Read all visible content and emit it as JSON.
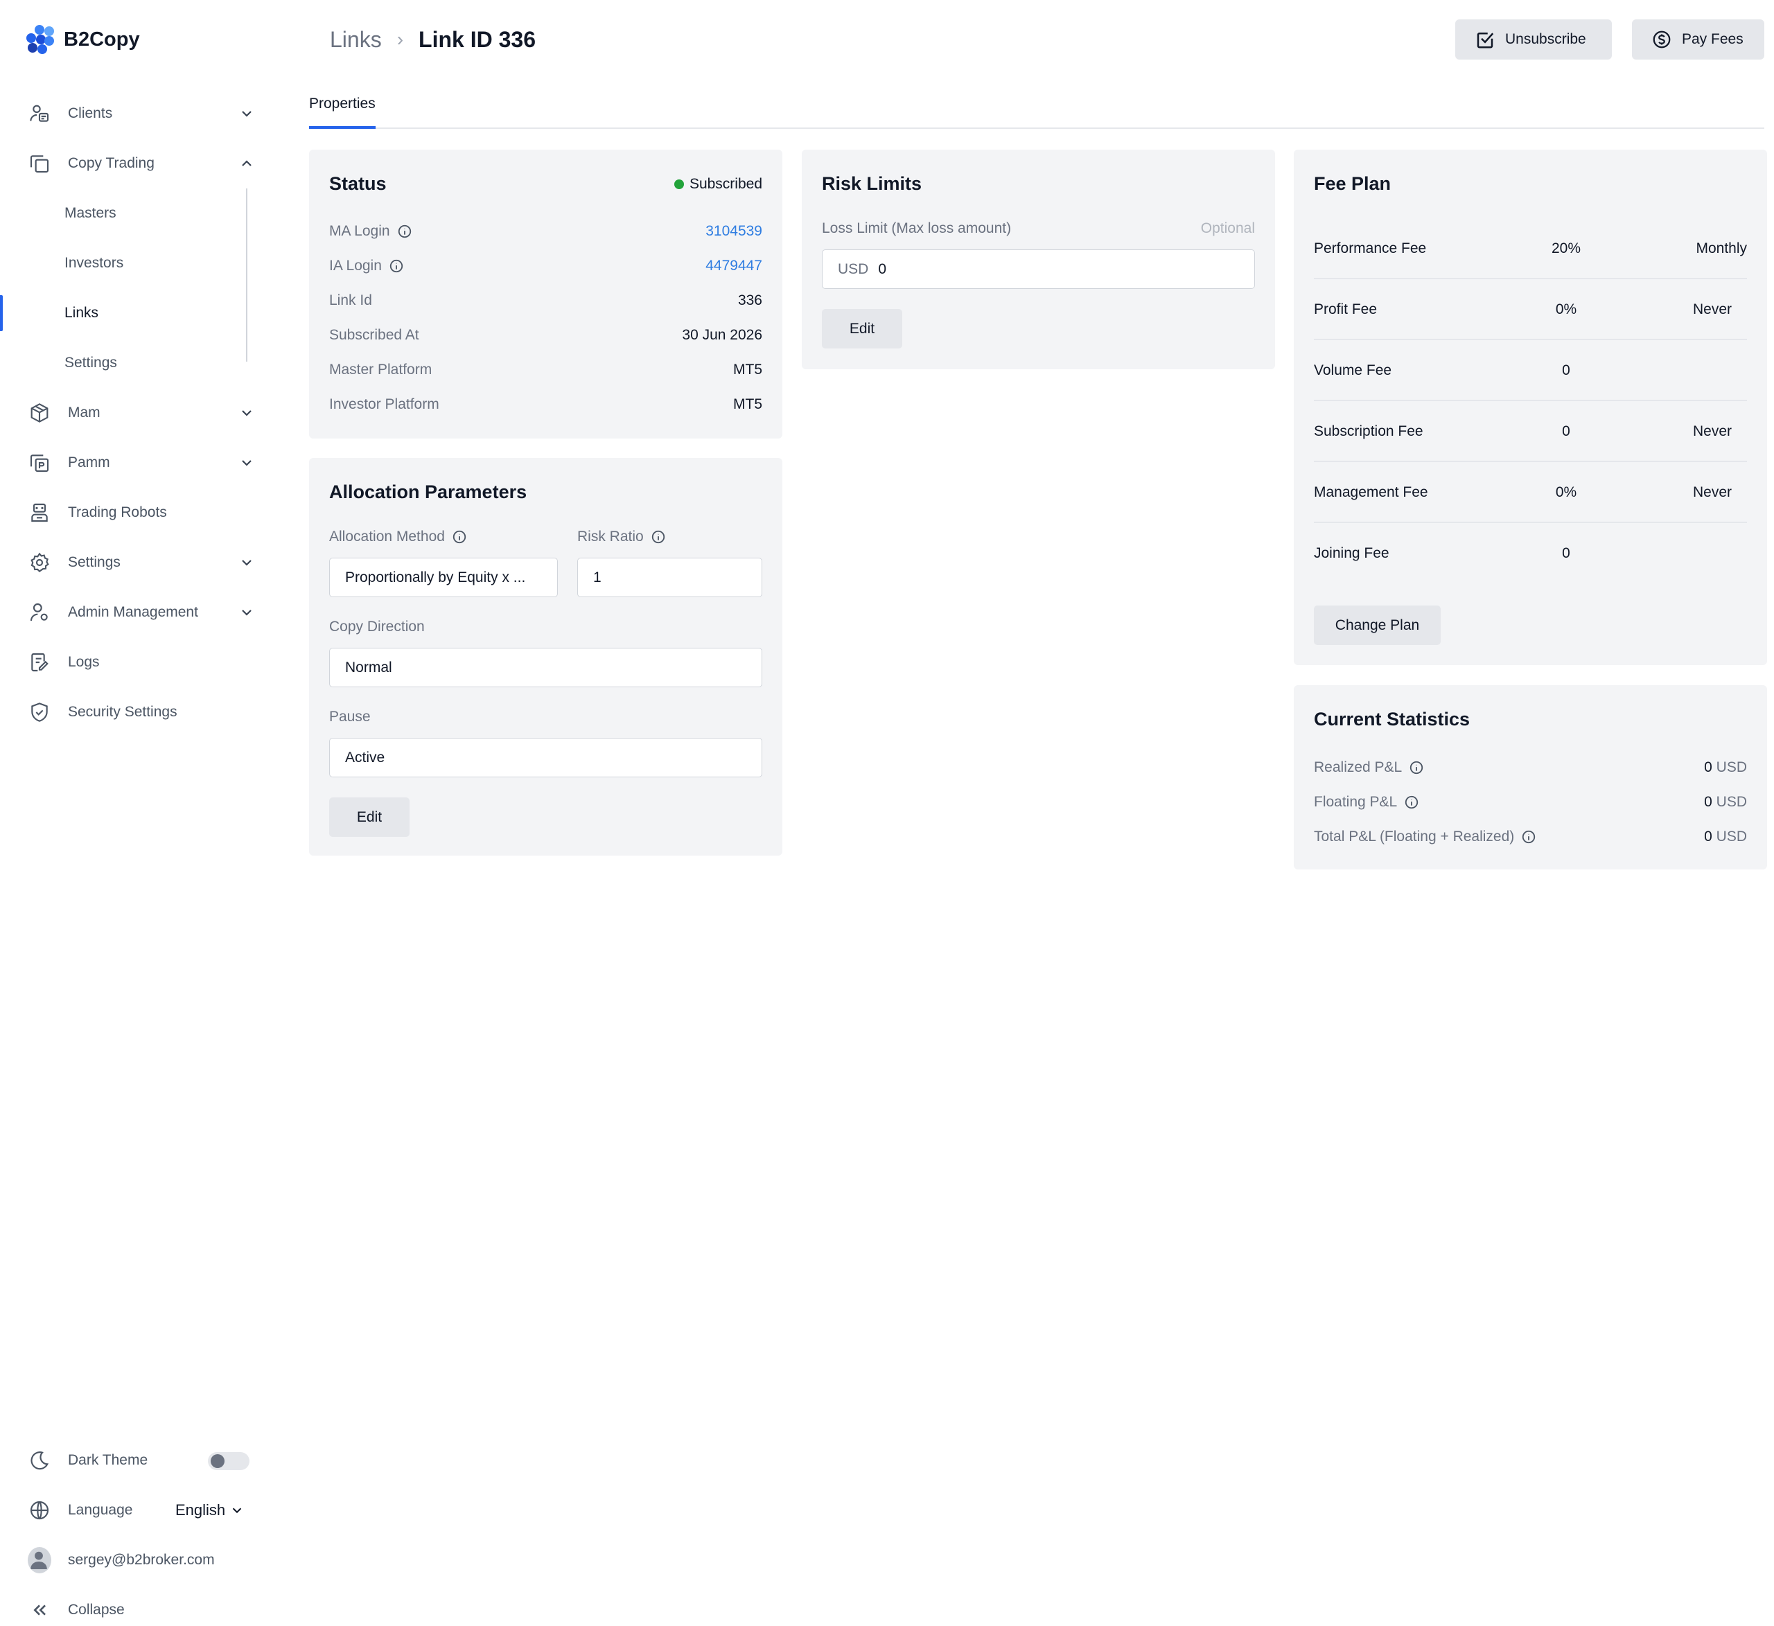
{
  "app": {
    "name": "B2Copy"
  },
  "sidebar": {
    "items": [
      {
        "label": "Clients",
        "icon": "users-icon",
        "expandable": true,
        "expanded": false
      },
      {
        "label": "Copy Trading",
        "icon": "copy-icon",
        "expandable": true,
        "expanded": true,
        "children": [
          {
            "label": "Masters"
          },
          {
            "label": "Investors"
          },
          {
            "label": "Links",
            "active": true
          },
          {
            "label": "Settings"
          }
        ]
      },
      {
        "label": "Mam",
        "icon": "cube-icon",
        "expandable": true,
        "expanded": false
      },
      {
        "label": "Pamm",
        "icon": "pamm-icon",
        "expandable": true,
        "expanded": false
      },
      {
        "label": "Trading Robots",
        "icon": "robot-icon",
        "expandable": false
      },
      {
        "label": "Settings",
        "icon": "gear-icon",
        "expandable": true,
        "expanded": false
      },
      {
        "label": "Admin Management",
        "icon": "admin-icon",
        "expandable": true,
        "expanded": false
      },
      {
        "label": "Logs",
        "icon": "logs-icon",
        "expandable": false
      },
      {
        "label": "Security Settings",
        "icon": "shield-icon",
        "expandable": false
      }
    ],
    "bottom": {
      "dark_theme_label": "Dark Theme",
      "dark_theme_on": false,
      "language_label": "Language",
      "language_value": "English",
      "user_email": "sergey@b2broker.com",
      "collapse_label": "Collapse"
    }
  },
  "header": {
    "breadcrumb_parent": "Links",
    "breadcrumb_current": "Link ID 336",
    "unsubscribe_label": "Unsubscribe",
    "pay_fees_label": "Pay Fees"
  },
  "tabs": [
    {
      "label": "Properties",
      "active": true
    }
  ],
  "status_card": {
    "title": "Status",
    "status_text": "Subscribed",
    "status_color": "#22a33a",
    "rows": [
      {
        "label": "MA Login",
        "value": "3104539",
        "info": true,
        "link": true
      },
      {
        "label": "IA Login",
        "value": "4479447",
        "info": true,
        "link": true
      },
      {
        "label": "Link Id",
        "value": "336"
      },
      {
        "label": "Subscribed At",
        "value": "30 Jun 2026"
      },
      {
        "label": "Master Platform",
        "value": "MT5"
      },
      {
        "label": "Investor Platform",
        "value": "MT5"
      }
    ]
  },
  "allocation_card": {
    "title": "Allocation Parameters",
    "allocation_method_label": "Allocation Method",
    "allocation_method_value": "Proportionally by Equity x ...",
    "risk_ratio_label": "Risk Ratio",
    "risk_ratio_value": "1",
    "copy_direction_label": "Copy Direction",
    "copy_direction_value": "Normal",
    "pause_label": "Pause",
    "pause_value": "Active",
    "edit_label": "Edit"
  },
  "risk_card": {
    "title": "Risk Limits",
    "loss_limit_label": "Loss Limit (Max loss amount)",
    "optional_label": "Optional",
    "currency": "USD",
    "value": "0",
    "edit_label": "Edit"
  },
  "fee_card": {
    "title": "Fee Plan",
    "rows": [
      {
        "name": "Performance Fee",
        "value": "20%",
        "period": "Monthly"
      },
      {
        "name": "Profit Fee",
        "value": "0%",
        "period": "Never"
      },
      {
        "name": "Volume Fee",
        "value": "0",
        "period": ""
      },
      {
        "name": "Subscription Fee",
        "value": "0",
        "period": "Never"
      },
      {
        "name": "Management Fee",
        "value": "0%",
        "period": "Never"
      },
      {
        "name": "Joining Fee",
        "value": "0",
        "period": ""
      }
    ],
    "change_plan_label": "Change Plan"
  },
  "stats_card": {
    "title": "Current Statistics",
    "rows": [
      {
        "label": "Realized P&L",
        "value": "0",
        "unit": "USD"
      },
      {
        "label": "Floating P&L",
        "value": "0",
        "unit": "USD"
      },
      {
        "label": "Total P&L (Floating + Realized)",
        "value": "0",
        "unit": "USD"
      }
    ]
  },
  "colors": {
    "accent": "#2563eb",
    "link": "#2f7de1",
    "card_bg": "#f3f4f6"
  }
}
